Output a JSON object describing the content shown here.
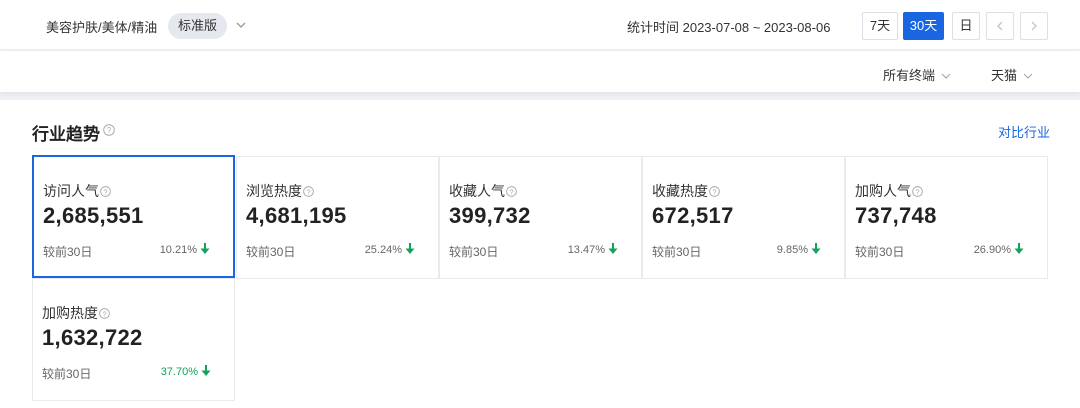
{
  "header": {
    "category": "美容护肤/美体/精油",
    "edition_badge": "标准版",
    "date_range": "统计时间 2023-07-08 ~ 2023-08-06",
    "range_buttons": [
      "7天",
      "30天",
      "日"
    ],
    "active_range": "30天"
  },
  "filters": {
    "terminal": "所有终端",
    "platform": "天猫"
  },
  "section": {
    "title": "行业趋势",
    "compare_link": "对比行业"
  },
  "colors": {
    "accent": "#1a66e0",
    "down_arrow": "#14a35a"
  },
  "metrics": [
    {
      "label": "访问人气",
      "value": "2,685,551",
      "compare_label": "较前30日",
      "change": "10.21%",
      "direction": "down"
    },
    {
      "label": "浏览热度",
      "value": "4,681,195",
      "compare_label": "较前30日",
      "change": "25.24%",
      "direction": "down"
    },
    {
      "label": "收藏人气",
      "value": "399,732",
      "compare_label": "较前30日",
      "change": "13.47%",
      "direction": "down"
    },
    {
      "label": "收藏热度",
      "value": "672,517",
      "compare_label": "较前30日",
      "change": "9.85%",
      "direction": "down"
    },
    {
      "label": "加购人气",
      "value": "737,748",
      "compare_label": "较前30日",
      "change": "26.90%",
      "direction": "down"
    },
    {
      "label": "加购热度",
      "value": "1,632,722",
      "compare_label": "较前30日",
      "change": "37.70%",
      "direction": "down"
    }
  ]
}
